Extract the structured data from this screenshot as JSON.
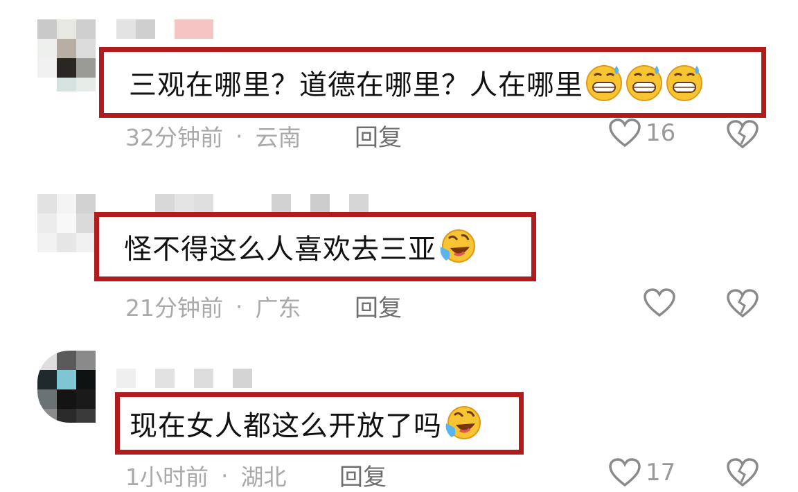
{
  "comments": [
    {
      "text": "三观在哪里？道德在哪里？人在哪里",
      "emojis": [
        "grin-sweat-icon",
        "grin-sweat-icon",
        "grin-sweat-icon"
      ],
      "time": "32分钟前",
      "location": "云南",
      "reply_label": "回复",
      "likes": "16"
    },
    {
      "text": "怪不得这么人喜欢去三亚",
      "emojis": [
        "laughing-tears-icon"
      ],
      "time": "21分钟前",
      "location": "广东",
      "reply_label": "回复",
      "likes": ""
    },
    {
      "text": "现在女人都这么开放了吗",
      "emojis": [
        "laughing-tears-icon"
      ],
      "time": "1小时前",
      "location": "湖北",
      "reply_label": "回复",
      "likes": "17"
    }
  ],
  "separator": "·",
  "colors": {
    "highlight_border": "#b11b1b",
    "meta_text": "#a9a9a9",
    "reply_text": "#6e6e6e"
  }
}
